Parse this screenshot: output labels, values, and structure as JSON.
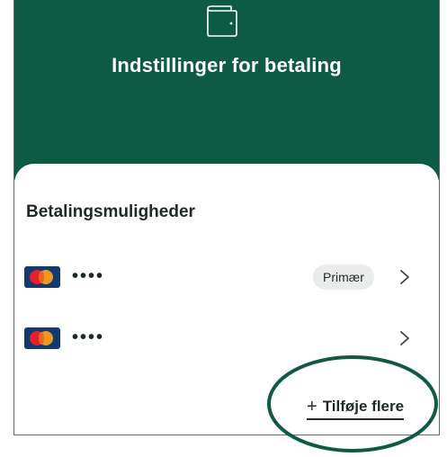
{
  "header": {
    "title": "Indstillinger for betaling",
    "icon": "wallet-icon",
    "background": "#0e5a45"
  },
  "payments": {
    "section_title": "Betalingsmuligheder",
    "methods": [
      {
        "brand_icon": "mastercard-icon",
        "masked": "••••",
        "badge": "Primær"
      },
      {
        "brand_icon": "mastercard-icon",
        "masked": "••••",
        "badge": ""
      }
    ],
    "add_more_label": "Tilføje flere",
    "add_icon": "plus-icon"
  },
  "annotation": {
    "color": "#0e5a45",
    "shape": "ellipse"
  }
}
